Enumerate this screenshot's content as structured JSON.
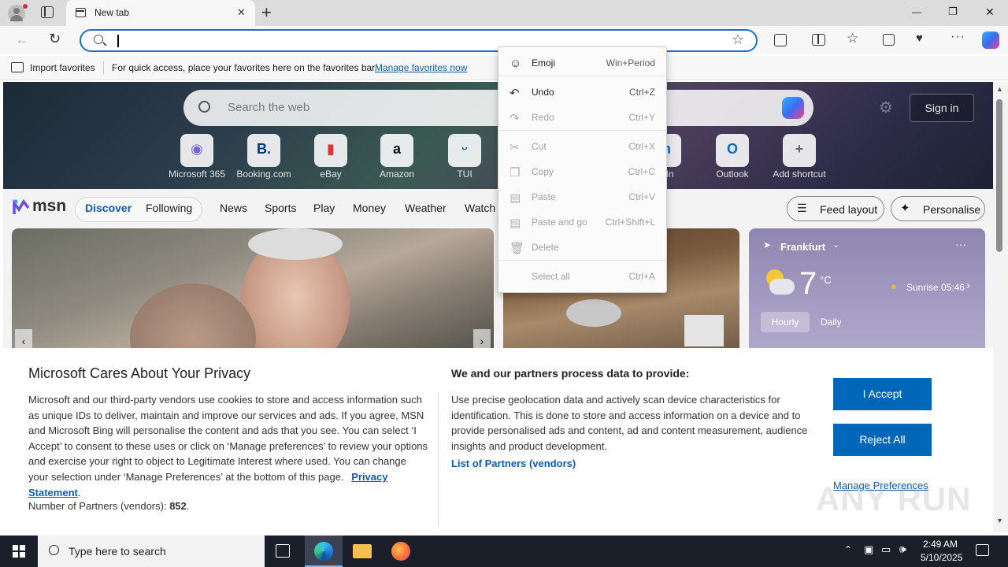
{
  "browser": {
    "tab_title": "New tab",
    "new_tab_symbol": "+",
    "window_controls": {
      "minimize": "—",
      "restore": "❐",
      "close": "✕"
    },
    "omnibox_placeholder": ""
  },
  "favorites_bar": {
    "import_label": "Import favorites",
    "hint": "For quick access, place your favorites here on the favorites bar.",
    "manage_link": "Manage favorites now"
  },
  "newtab": {
    "search_placeholder": "Search the web",
    "sign_in": "Sign in",
    "shortcuts": [
      {
        "label": "Microsoft 365",
        "icon": "microsoft365-icon",
        "glyph": "◉",
        "color": "#7b61d9"
      },
      {
        "label": "Booking.com",
        "icon": "booking-icon",
        "glyph": "B.",
        "color": "#003580"
      },
      {
        "label": "eBay",
        "icon": "ebay-icon",
        "glyph": "▮",
        "color": "#e53238"
      },
      {
        "label": "Amazon",
        "icon": "amazon-icon",
        "glyph": "a",
        "color": "#111111"
      },
      {
        "label": "TUI",
        "icon": "tui-icon",
        "glyph": "ᵕ",
        "color": "#1c63b7"
      },
      {
        "label": "edIn",
        "icon": "linkedin-icon",
        "glyph": "in",
        "color": "#0a66c2"
      },
      {
        "label": "Outlook",
        "icon": "outlook-icon",
        "glyph": "O",
        "color": "#0f6cbd"
      },
      {
        "label": "Add shortcut",
        "icon": "plus-icon",
        "glyph": "+",
        "color": "#666666"
      }
    ]
  },
  "msn": {
    "logo_text": "msn",
    "tabs": [
      "Discover",
      "Following"
    ],
    "nav": [
      "News",
      "Sports",
      "Play",
      "Money",
      "Weather",
      "Watch"
    ],
    "feed_layout": "Feed layout",
    "personalise": "Personalise"
  },
  "weather": {
    "city": "Frankfurt",
    "temp": "7",
    "unit": "°C",
    "sunrise": "Sunrise 05:46",
    "tabs": [
      "Hourly",
      "Daily"
    ]
  },
  "context_menu": {
    "items": [
      {
        "label": "Emoji",
        "shortcut": "Win+Period",
        "icon": "emoji-icon",
        "disabled": false
      },
      {
        "label": "Undo",
        "shortcut": "Ctrl+Z",
        "icon": "undo-icon",
        "disabled": false
      },
      {
        "label": "Redo",
        "shortcut": "Ctrl+Y",
        "icon": "redo-icon",
        "disabled": true
      },
      {
        "label": "Cut",
        "shortcut": "Ctrl+X",
        "icon": "cut-icon",
        "disabled": true
      },
      {
        "label": "Copy",
        "shortcut": "Ctrl+C",
        "icon": "copy-icon",
        "disabled": true
      },
      {
        "label": "Paste",
        "shortcut": "Ctrl+V",
        "icon": "paste-icon",
        "disabled": true
      },
      {
        "label": "Paste and go",
        "shortcut": "Ctrl+Shift+L",
        "icon": "paste-go-icon",
        "disabled": true
      },
      {
        "label": "Delete",
        "shortcut": "",
        "icon": "delete-icon",
        "disabled": true
      },
      {
        "label": "Select all",
        "shortcut": "Ctrl+A",
        "icon": "",
        "disabled": true
      }
    ]
  },
  "privacy": {
    "title": "Microsoft Cares About Your Privacy",
    "body": "Microsoft and our third-party vendors use cookies to store and access information such as unique IDs to deliver, maintain and improve our services and ads. If you agree, MSN and Microsoft Bing will personalise the content and ads that you see. You can select ‘I Accept’ to consent to these uses or click on ‘Manage preferences’ to review your options and exercise your right to object to Legitimate Interest where used.  You can change your selection under ‘Manage Preferences’ at the bottom of this page.",
    "statement_link": "Privacy Statement",
    "partners_prefix": "Number of Partners (vendors):",
    "partners_count": "852",
    "right_title": "We and our partners process data to provide:",
    "right_body": "Use precise geolocation data and actively scan device characteristics for identification. This is done to store and access information on a device and to provide personalised ads and content, ad and content measurement, audience insights and product development.",
    "partners_link": "List of Partners (vendors)",
    "accept": "I Accept",
    "reject": "Reject All",
    "manage": "Manage Preferences"
  },
  "taskbar": {
    "search_placeholder": "Type here to search",
    "time": "2:49 AM",
    "date": "5/10/2025"
  },
  "watermark": "ANY RUN",
  "colors": {
    "accent": "#0067b8",
    "link": "#0f5da8",
    "omnibox_border": "#1a73c8"
  }
}
